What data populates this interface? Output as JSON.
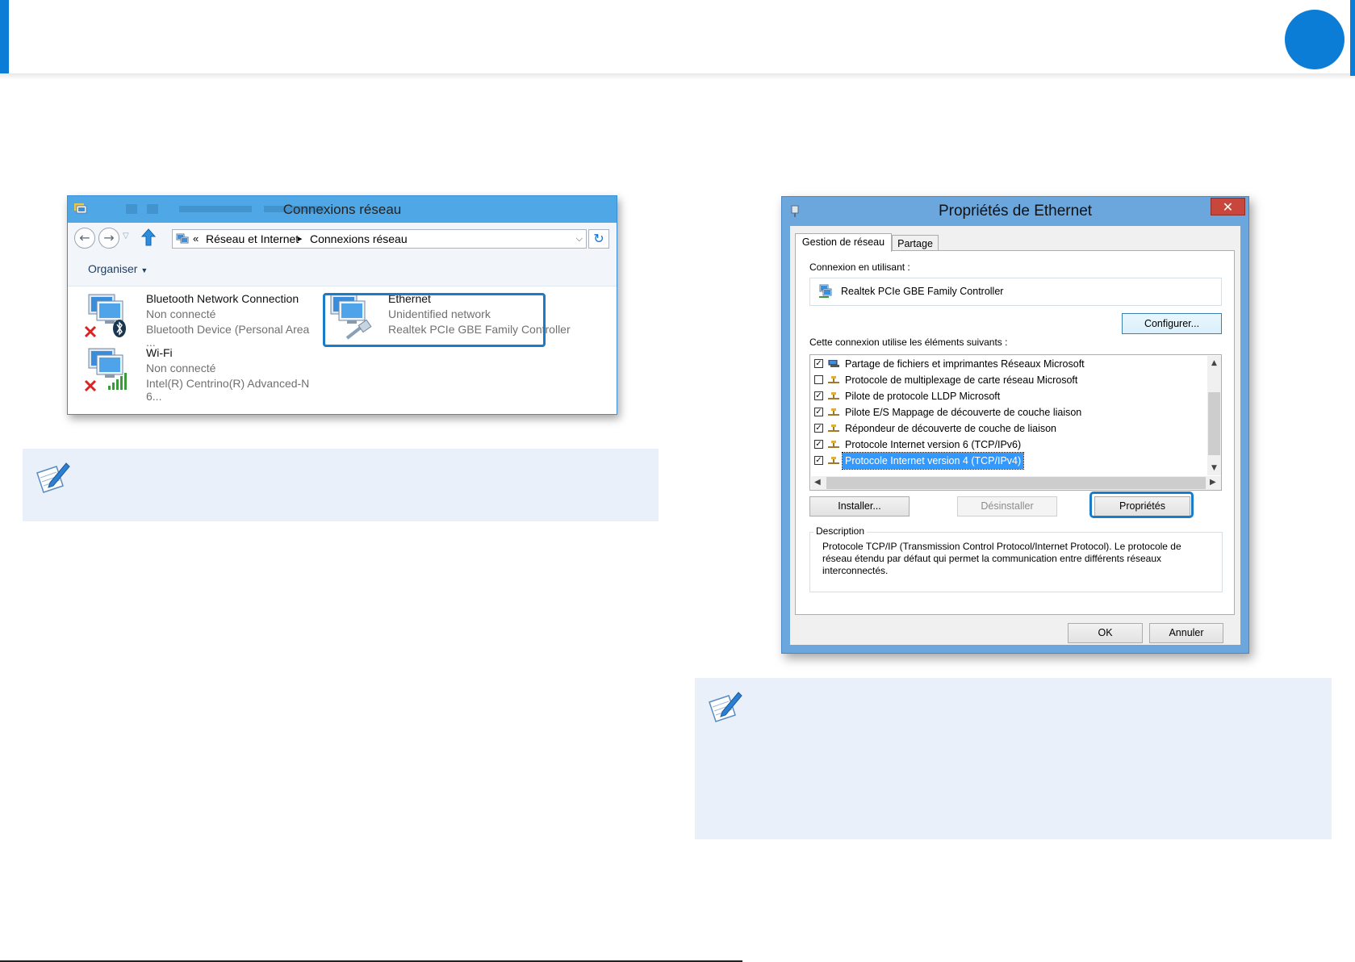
{
  "colors": {
    "accent": "#0b7dd6",
    "note_bg": "#e9f0f9",
    "highlight": "#1a7bc9",
    "selection": "#3399ff"
  },
  "connections_window": {
    "title": "Connexions réseau",
    "address": {
      "chevrons": "«",
      "segment1": "Réseau et Internet",
      "separator": "▸",
      "segment2": "Connexions réseau"
    },
    "toolbar": {
      "organize": "Organiser"
    },
    "items": [
      {
        "name": "Bluetooth Network Connection",
        "status": "Non connecté",
        "device": "Bluetooth Device (Personal Area ...",
        "icon": "bluetooth-network-icon"
      },
      {
        "name": "Ethernet",
        "status": "Unidentified network",
        "device": "Realtek PCIe GBE Family Controller",
        "icon": "ethernet-network-icon"
      },
      {
        "name": "Wi-Fi",
        "status": "Non connecté",
        "device": "Intel(R) Centrino(R) Advanced-N 6...",
        "icon": "wifi-network-icon"
      }
    ]
  },
  "properties_window": {
    "title": "Propriétés de Ethernet",
    "close": "✕",
    "tabs": [
      "Gestion de réseau",
      "Partage"
    ],
    "connect_using_label": "Connexion en utilisant :",
    "adapter": "Realtek PCIe GBE Family Controller",
    "configure_button": "Configurer...",
    "items_label": "Cette connexion utilise les éléments suivants :",
    "items": [
      {
        "label": "Partage de fichiers et imprimantes Réseaux Microsoft",
        "checked": true
      },
      {
        "label": "Protocole de multiplexage de carte réseau Microsoft",
        "checked": false
      },
      {
        "label": "Pilote de protocole LLDP Microsoft",
        "checked": true
      },
      {
        "label": "Pilote E/S Mappage de découverte de couche liaison",
        "checked": true
      },
      {
        "label": "Répondeur de découverte de couche de liaison",
        "checked": true
      },
      {
        "label": "Protocole Internet version 6 (TCP/IPv6)",
        "checked": true
      },
      {
        "label": "Protocole Internet version 4 (TCP/IPv4)",
        "checked": true,
        "selected": true
      }
    ],
    "install_button": "Installer...",
    "uninstall_button": "Désinstaller",
    "properties_button": "Propriétés",
    "description_label": "Description",
    "description_text": "Protocole TCP/IP (Transmission Control Protocol/Internet Protocol). Le protocole de réseau étendu par défaut qui permet la communication entre différents réseaux interconnectés.",
    "ok_button": "OK",
    "cancel_button": "Annuler"
  }
}
